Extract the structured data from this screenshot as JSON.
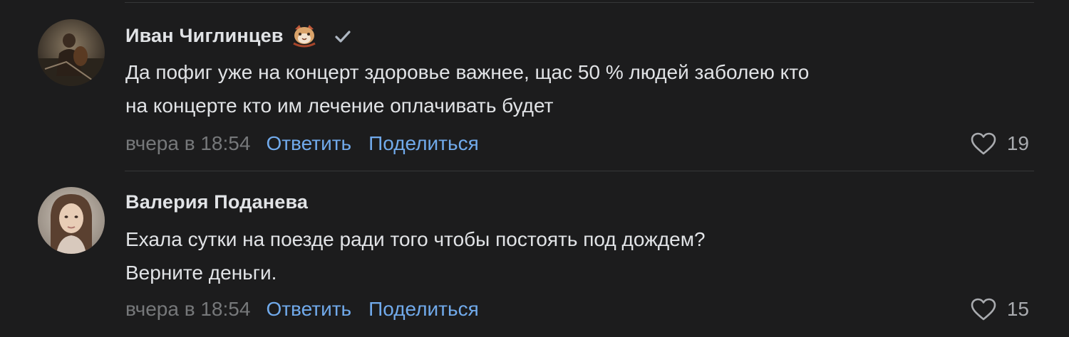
{
  "comments": [
    {
      "author": "Иван Чиглинцев",
      "author_emoji": "cat-face-emoji-icon",
      "verified_icon": "checkmark-icon",
      "text_lines": [
        "Да пофиг уже на концерт здоровье важнее, щас 50 % людей заболею кто",
        "на концерте кто им лечение оплачивать будет"
      ],
      "timestamp": "вчера в 18:54",
      "reply_label": "Ответить",
      "share_label": "Поделиться",
      "likes": "19"
    },
    {
      "author": "Валерия Поданева",
      "text_lines": [
        "Ехала сутки на поезде ради того чтобы постоять под дождем?",
        "Верните деньги."
      ],
      "timestamp": "вчера в 18:54",
      "reply_label": "Ответить",
      "share_label": "Поделиться",
      "likes": "15"
    }
  ],
  "colors": {
    "background": "#1c1c1d",
    "text": "#e1e3e6",
    "secondary_text": "#76787a",
    "link": "#71aaeb",
    "divider": "#363738"
  }
}
